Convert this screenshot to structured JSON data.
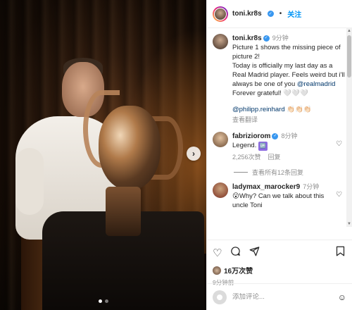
{
  "header": {
    "username": "toni.kr8s",
    "follow_label": "关注"
  },
  "caption": {
    "username": "toni.kr8s",
    "time": "9分钟",
    "text": "Picture 1 shows the missing piece of picture 2!\nToday is officially my last day as a Real Madrid player. Feels weird but i'll always be one of you ",
    "mention": "@realmadrid",
    "text_after": " Forever grateful! 🤍🤍🤍",
    "tag": "@philipp.reinhard",
    "tag_emoji": " 👏🏻👏🏻👏🏻",
    "translate_label": "查看翻译"
  },
  "comments": [
    {
      "username": "fabriziorom",
      "verified": true,
      "time": "8分钟",
      "text": "Legend. ",
      "badge": "🆙",
      "likes": "2,256次赞",
      "reply_label": "回复"
    },
    {
      "username": "ladymax_marocker9",
      "verified": false,
      "time": "7分钟",
      "text": "😮Why? Can we talk about this uncle Toni"
    }
  ],
  "view_replies_label": "查看所有12条回复",
  "actions": {
    "like_icon": "heart-icon",
    "comment_icon": "comment-icon",
    "share_icon": "share-icon",
    "save_icon": "bookmark-icon"
  },
  "likes_count": "16万次赞",
  "posted_time": "9分钟前",
  "comment_input": {
    "placeholder": "添加评论..."
  },
  "carousel": {
    "total": 2,
    "active": 1
  }
}
